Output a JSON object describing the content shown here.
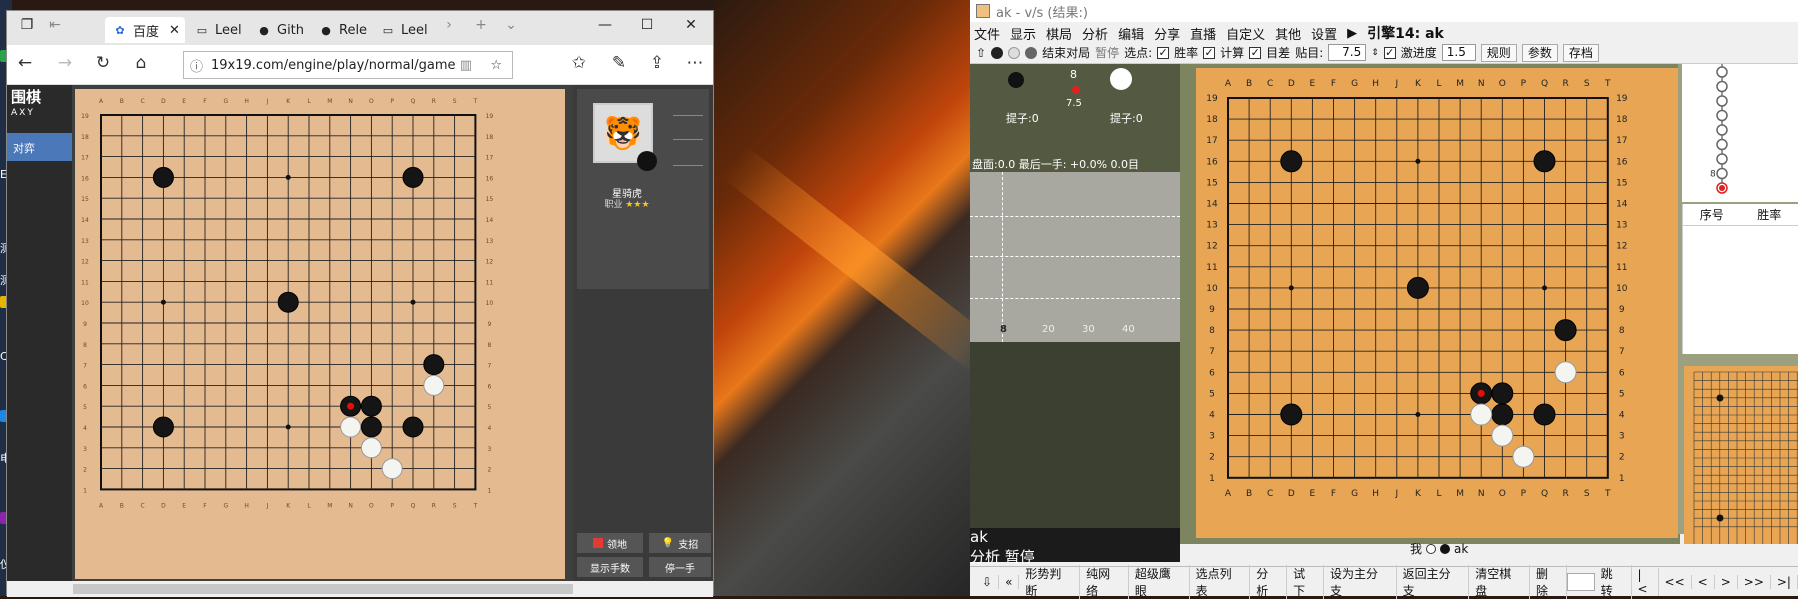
{
  "desktop": {
    "labels": [
      "E(",
      "测试)",
      "测试)",
      "C",
      "电",
      "仪"
    ],
    "icon_colors": [
      "#2aa24a",
      "#e8b400",
      "#c33",
      "#1e88e5",
      "#8e24aa",
      "#2aa24a"
    ]
  },
  "browser": {
    "tabs": [
      {
        "label": "百度",
        "icon": "baidu-paw-icon"
      },
      {
        "label": "Leel",
        "icon": "page-icon"
      },
      {
        "label": "Gith",
        "icon": "github-icon"
      },
      {
        "label": "Rele",
        "icon": "github-icon"
      },
      {
        "label": "Leel",
        "icon": "page-icon"
      }
    ],
    "url": "19x19.com/engine/play/normal/game",
    "logo_main": "围棋",
    "logo_sub": "AXY",
    "nav_selected": "对弈",
    "player": {
      "name": "星骑虎",
      "rank_label": "职业",
      "stars": "★★★"
    },
    "buttons": {
      "territory": "领地",
      "support": "支招",
      "show_moves": "显示手数",
      "stop": "停一手"
    },
    "board": {
      "columns": [
        "A",
        "B",
        "C",
        "D",
        "E",
        "F",
        "G",
        "H",
        "J",
        "K",
        "L",
        "M",
        "N",
        "O",
        "P",
        "Q",
        "R",
        "S",
        "T"
      ],
      "rows": [
        "19",
        "18",
        "17",
        "16",
        "15",
        "14",
        "13",
        "12",
        "11",
        "10",
        "9",
        "8",
        "7",
        "6",
        "5",
        "4",
        "3",
        "2",
        "1"
      ],
      "black_stones": [
        "D16",
        "Q16",
        "K10",
        "R7",
        "D4",
        "Q4",
        "O5",
        "O4",
        "N5"
      ],
      "white_stones": [
        "R6",
        "N4",
        "O3",
        "P2"
      ],
      "last_move": "N5"
    }
  },
  "lizzie": {
    "title": "ak - v/s (结果:)",
    "menu": [
      "文件",
      "显示",
      "棋局",
      "分析",
      "编辑",
      "分享",
      "直播",
      "自定义",
      "其他",
      "设置"
    ],
    "engine_label": "引擎14: ak",
    "toolbar": {
      "end_game": "结束对局",
      "pause": "暂停",
      "select_point": "选点:",
      "winrate": "胜率",
      "calc": "计算",
      "diff": "目差",
      "komi_label": "贴目:",
      "komi": "7.5",
      "progress_label": "激进度",
      "progress": "1.5",
      "rules": "规则",
      "params": "参数",
      "save": "存档"
    },
    "capture": {
      "black_label": "提子:0",
      "white_label": "提子:0",
      "move_number": "8",
      "komi": "7.5"
    },
    "eval_text": "盘面:0.0 最后一手: +0.0% 0.0目",
    "graph_ticks": [
      "8",
      "20",
      "30",
      "40"
    ],
    "status": {
      "engine": "ak",
      "mode": "分析 暂停"
    },
    "players_label": {
      "me": "我",
      "engine": "ak"
    },
    "table_headers": [
      "序号",
      "胜率"
    ],
    "bottom_buttons": [
      "形势判断",
      "纯网络",
      "超级鹰眼",
      "选点列表",
      "分析",
      "试下",
      "设为主分支",
      "返回主分支",
      "清空棋盘",
      "删除",
      "跳转",
      "|<",
      "<<",
      "<",
      ">",
      ">>",
      ">|"
    ],
    "board": {
      "columns": [
        "A",
        "B",
        "C",
        "D",
        "E",
        "F",
        "G",
        "H",
        "J",
        "K",
        "L",
        "M",
        "N",
        "O",
        "P",
        "Q",
        "R",
        "S",
        "T"
      ],
      "black_stones": [
        "D16",
        "Q16",
        "K10",
        "R8",
        "D4",
        "Q4",
        "O5",
        "O4",
        "N5"
      ],
      "white_stones": [
        "R6",
        "N4",
        "O3",
        "P2"
      ],
      "last_move": "N5"
    }
  }
}
